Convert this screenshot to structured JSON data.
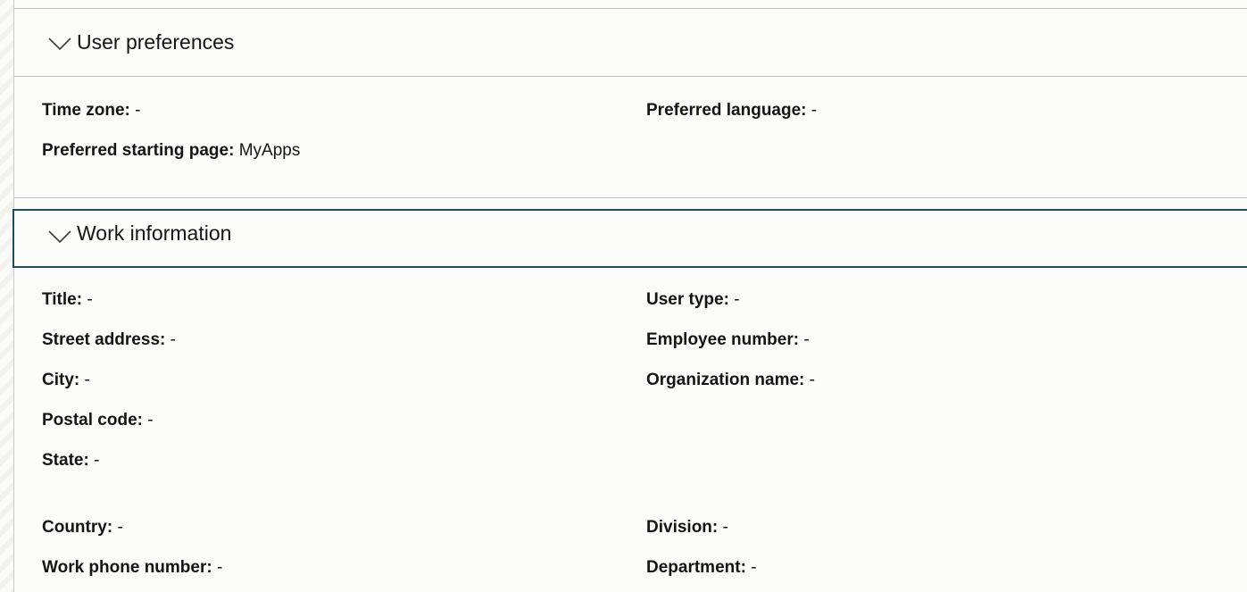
{
  "user_preferences": {
    "title": "User preferences",
    "fields": {
      "time_zone": {
        "label": "Time zone:",
        "value": "-"
      },
      "preferred_language": {
        "label": "Preferred language:",
        "value": "-"
      },
      "preferred_starting_page": {
        "label": "Preferred starting page:",
        "value": "MyApps"
      }
    }
  },
  "work_information": {
    "title": "Work information",
    "fields": {
      "title": {
        "label": "Title:",
        "value": "-"
      },
      "user_type": {
        "label": "User type:",
        "value": "-"
      },
      "street_address": {
        "label": "Street address:",
        "value": "-"
      },
      "employee_number": {
        "label": "Employee number:",
        "value": "-"
      },
      "city": {
        "label": "City:",
        "value": "-"
      },
      "organization_name": {
        "label": "Organization name:",
        "value": "-"
      },
      "postal_code": {
        "label": "Postal code:",
        "value": "-"
      },
      "state": {
        "label": "State:",
        "value": "-"
      },
      "country": {
        "label": "Country:",
        "value": "-"
      },
      "division": {
        "label": "Division:",
        "value": "-"
      },
      "work_phone_number": {
        "label": "Work phone number:",
        "value": "-"
      },
      "department": {
        "label": "Department:",
        "value": "-"
      }
    }
  },
  "colors": {
    "focus_border": "#1e4a5e",
    "divider": "#c9c8c4",
    "text": "#161513"
  }
}
